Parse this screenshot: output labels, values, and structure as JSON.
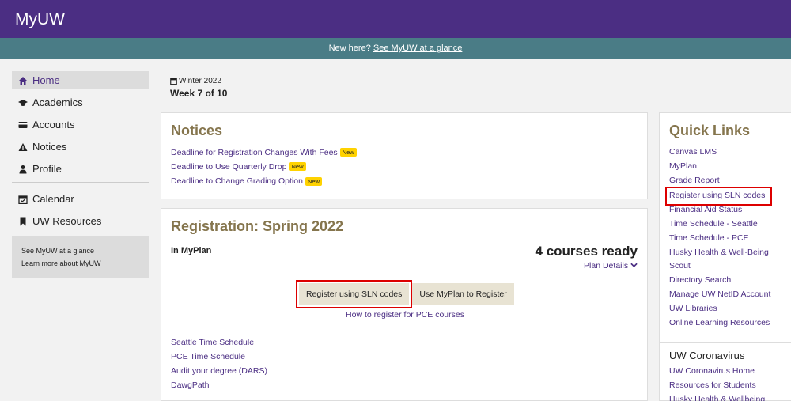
{
  "app": {
    "title": "MyUW"
  },
  "glance": {
    "prefix": "New here?",
    "link": "See MyUW at a glance"
  },
  "sidebar": {
    "items": [
      {
        "label": "Home",
        "icon": "home-icon"
      },
      {
        "label": "Academics",
        "icon": "graduation-cap-icon"
      },
      {
        "label": "Accounts",
        "icon": "credit-card-icon"
      },
      {
        "label": "Notices",
        "icon": "warning-icon"
      },
      {
        "label": "Profile",
        "icon": "user-icon"
      },
      {
        "label": "Calendar",
        "icon": "calendar-icon"
      },
      {
        "label": "UW Resources",
        "icon": "bookmark-icon"
      }
    ],
    "box": {
      "link1": "See MyUW at a glance",
      "link2": "Learn more about MyUW"
    }
  },
  "term": {
    "quarter": "Winter 2022",
    "week": "Week 7 of 10"
  },
  "notices": {
    "title": "Notices",
    "badge": "New",
    "items": [
      "Deadline for Registration Changes With Fees",
      "Deadline to Use Quarterly Drop",
      "Deadline to Change Grading Option"
    ]
  },
  "registration": {
    "title": "Registration: Spring 2022",
    "in_myplan": "In MyPlan",
    "ready": "4 courses ready",
    "plan_details": "Plan Details",
    "btn_sln": "Register using SLN codes",
    "btn_myplan": "Use MyPlan to Register",
    "pce_link": "How to register for PCE courses",
    "links": [
      "Seattle Time Schedule",
      "PCE Time Schedule",
      "Audit your degree (DARS)",
      "DawgPath"
    ]
  },
  "quicklinks": {
    "title": "Quick Links",
    "links": [
      "Canvas LMS",
      "MyPlan",
      "Grade Report",
      "Register using SLN codes",
      "Financial Aid Status",
      "Time Schedule - Seattle",
      "Time Schedule - PCE",
      "Husky Health & Well-Being",
      "Scout",
      "Directory Search",
      "Manage UW NetID Account",
      "UW Libraries",
      "Online Learning Resources"
    ],
    "subhead": "UW Coronavirus",
    "corona_links": [
      "UW Coronavirus Home",
      "Resources for Students",
      "Husky Health & Wellbeing"
    ]
  },
  "colors": {
    "purple": "#4b2e83",
    "gold": "#85754d",
    "teal": "#4a7c86",
    "highlight": "#dd0000"
  }
}
